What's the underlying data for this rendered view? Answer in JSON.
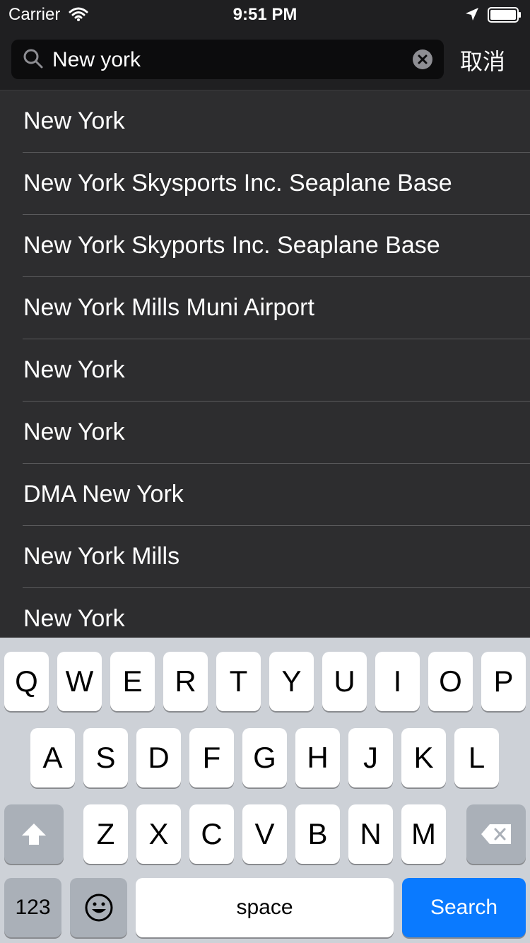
{
  "status_bar": {
    "carrier": "Carrier",
    "time": "9:51 PM",
    "icons": [
      "wifi-icon",
      "location-arrow-icon",
      "battery-icon"
    ]
  },
  "search": {
    "value": "New york",
    "cancel_label": "取消",
    "icons": [
      "search-icon",
      "clear-icon"
    ]
  },
  "results": [
    "New York",
    "New York Skysports Inc. Seaplane Base",
    "New York Skyports Inc. Seaplane Base",
    "New York Mills Muni Airport",
    "New York",
    "New York",
    "DMA New York",
    "New York Mills",
    "New York"
  ],
  "keyboard": {
    "row1": [
      "Q",
      "W",
      "E",
      "R",
      "T",
      "Y",
      "U",
      "I",
      "O",
      "P"
    ],
    "row2": [
      "A",
      "S",
      "D",
      "F",
      "G",
      "H",
      "J",
      "K",
      "L"
    ],
    "row3": [
      "Z",
      "X",
      "C",
      "V",
      "B",
      "N",
      "M"
    ],
    "numbers_label": "123",
    "space_label": "space",
    "search_label": "Search",
    "icons": [
      "shift-icon",
      "delete-icon",
      "emoji-icon"
    ]
  },
  "colors": {
    "accent": "#0a7aff",
    "header_bg": "#1f1f21",
    "list_bg": "#2d2d2f",
    "keyboard_bg": "#cdd1d7"
  }
}
